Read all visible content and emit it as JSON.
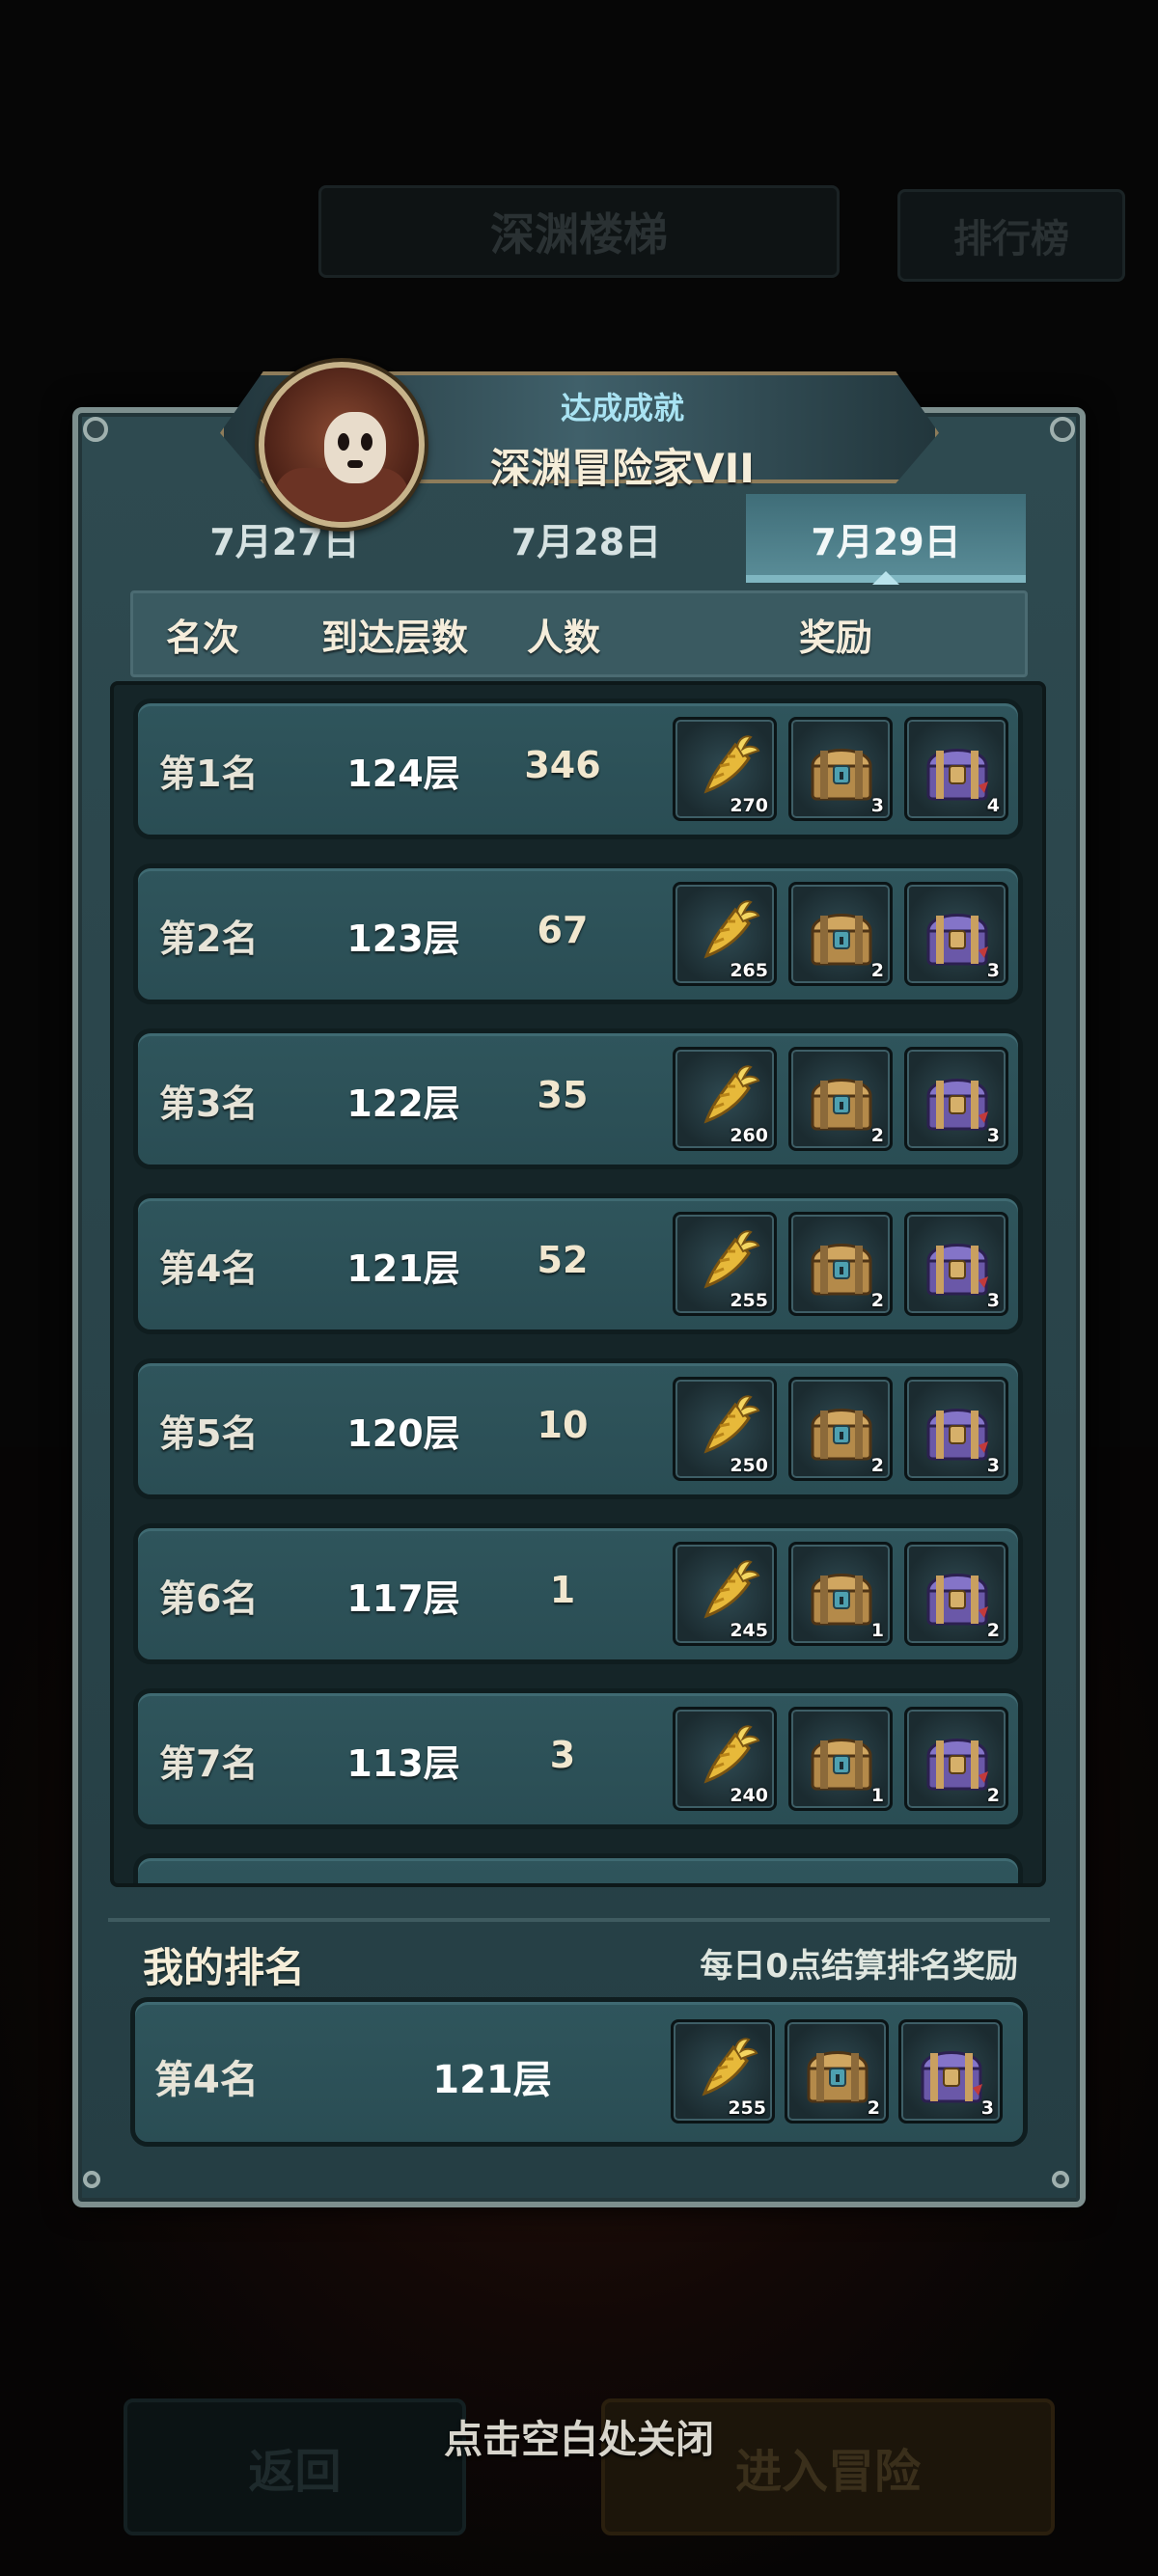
{
  "background": {
    "title": "深渊楼梯",
    "leaderboard_button": "排行榜",
    "back_button": "返回",
    "enter_button": "进入冒险",
    "close_hint": "点击空白处关闭"
  },
  "achievement": {
    "subtitle": "达成成就",
    "title": "深渊冒险家VII"
  },
  "tabs": [
    {
      "label": "7月27日",
      "selected": false
    },
    {
      "label": "7月28日",
      "selected": false
    },
    {
      "label": "7月29日",
      "selected": true
    }
  ],
  "columns": {
    "rank": "名次",
    "floor": "到达层数",
    "count": "人数",
    "reward": "奖励"
  },
  "rows": [
    {
      "rank": "第1名",
      "floor": "124层",
      "count": "346",
      "rewards": [
        "270",
        "3",
        "4"
      ]
    },
    {
      "rank": "第2名",
      "floor": "123层",
      "count": "67",
      "rewards": [
        "265",
        "2",
        "3"
      ]
    },
    {
      "rank": "第3名",
      "floor": "122层",
      "count": "35",
      "rewards": [
        "260",
        "2",
        "3"
      ]
    },
    {
      "rank": "第4名",
      "floor": "121层",
      "count": "52",
      "rewards": [
        "255",
        "2",
        "3"
      ]
    },
    {
      "rank": "第5名",
      "floor": "120层",
      "count": "10",
      "rewards": [
        "250",
        "2",
        "3"
      ]
    },
    {
      "rank": "第6名",
      "floor": "117层",
      "count": "1",
      "rewards": [
        "245",
        "1",
        "2"
      ]
    },
    {
      "rank": "第7名",
      "floor": "113层",
      "count": "3",
      "rewards": [
        "240",
        "1",
        "2"
      ]
    }
  ],
  "reward_icons": [
    "carrot-icon",
    "gold-chest-icon",
    "purple-chest-icon"
  ],
  "my_rank": {
    "title": "我的排名",
    "note": "每日0点结算排名奖励",
    "rank": "第4名",
    "floor": "121层",
    "rewards": [
      "255",
      "2",
      "3"
    ]
  },
  "colors": {
    "panel": "#2e4a50",
    "row": "#2f555c",
    "selected_tab": "#5b8e99",
    "banner_text": "#a9e3f3"
  }
}
